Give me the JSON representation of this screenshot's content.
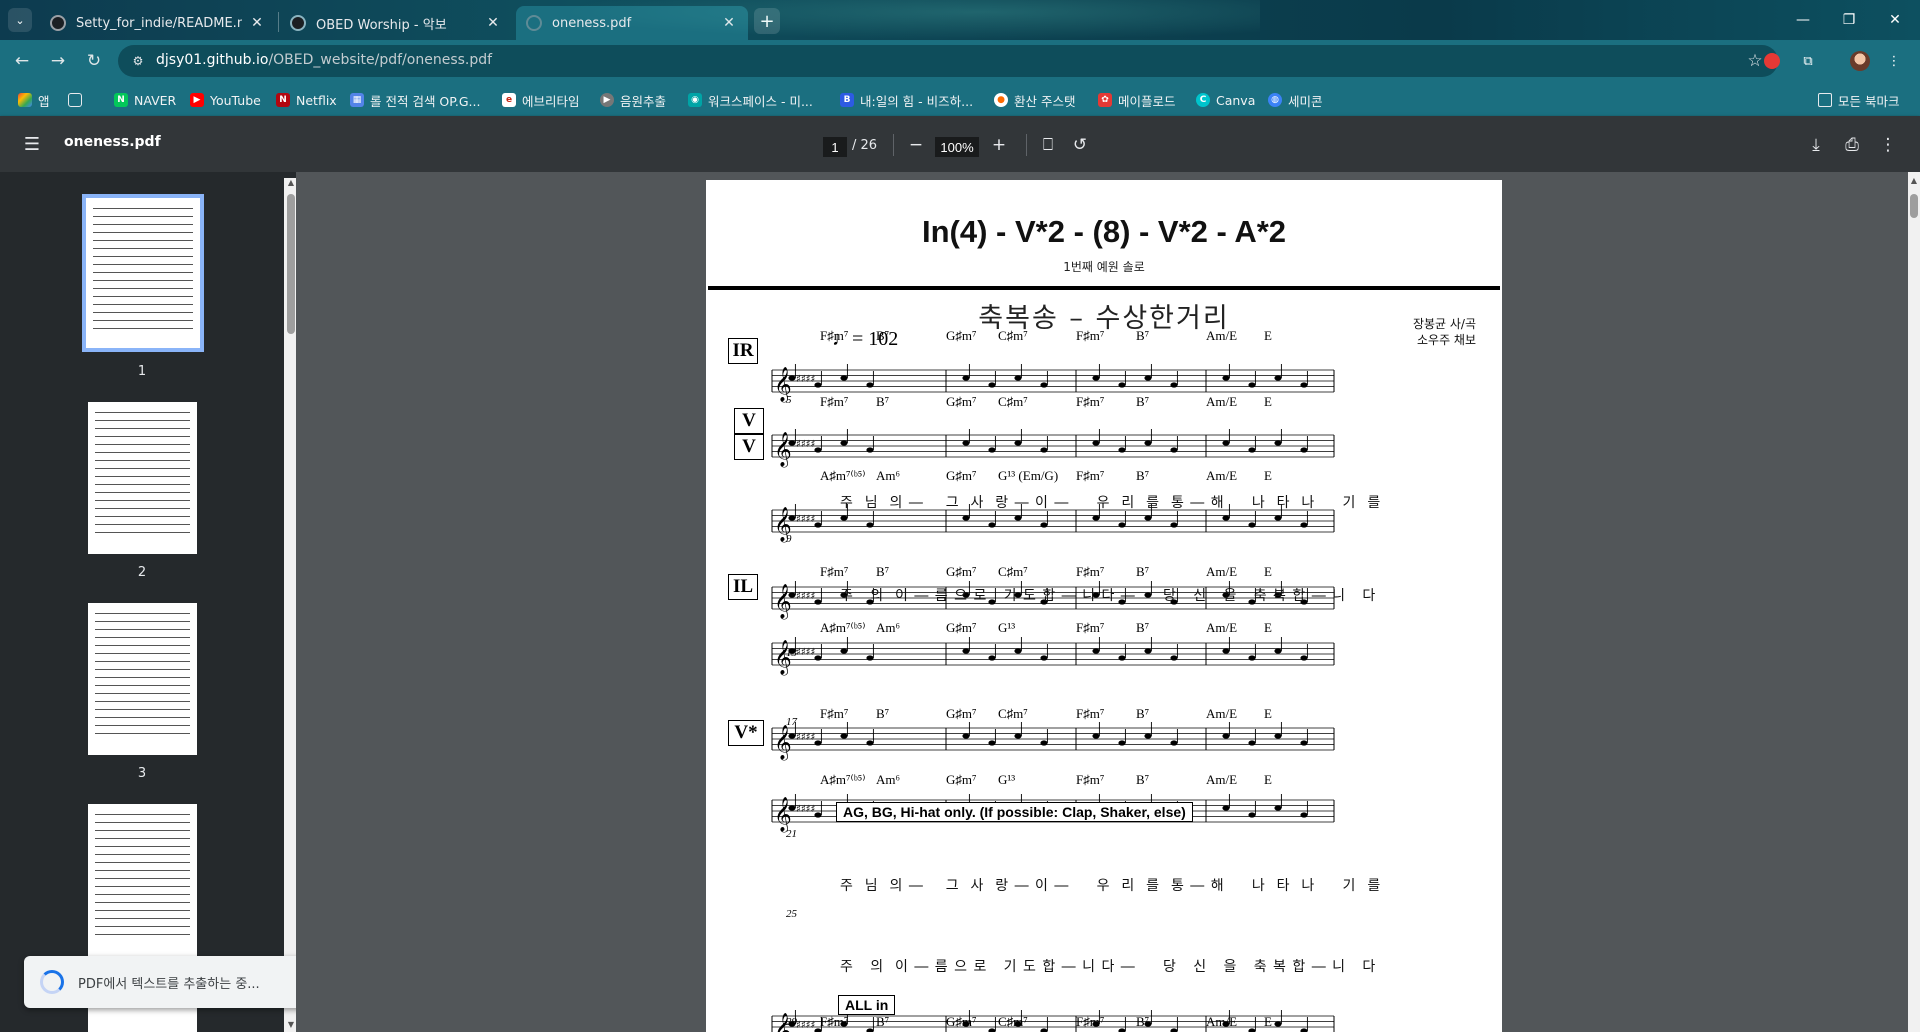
{
  "tabs": [
    {
      "title": "Setty_for_indie/README.md at",
      "close": "✕"
    },
    {
      "title": "OBED Worship - 악보",
      "close": "✕"
    },
    {
      "title": "oneness.pdf",
      "close": "✕"
    }
  ],
  "address": {
    "host": "djsy01.github.io",
    "path": "/OBED_website/pdf/oneness.pdf"
  },
  "bookmarks": {
    "items": [
      {
        "label": "앱",
        "color": "#ea4335"
      },
      {
        "label": "",
        "color": "#5f6368"
      },
      {
        "label": "NAVER",
        "color": "#03c75a"
      },
      {
        "label": "YouTube",
        "color": "#ff0000"
      },
      {
        "label": "Netflix",
        "color": "#b20710"
      },
      {
        "label": "롤 전적 검색 OP.G...",
        "color": "#5383e8"
      },
      {
        "label": "에브리타임",
        "color": "#c62917"
      },
      {
        "label": "음원추출",
        "color": "#444444"
      },
      {
        "label": "워크스페이스 - 미...",
        "color": "#00a4a6"
      },
      {
        "label": "내:일의 힘 - 비즈하...",
        "color": "#2d5be3"
      },
      {
        "label": "환산 주스탯",
        "color": "#ff6b00"
      },
      {
        "label": "메이플로드",
        "color": "#e53935"
      },
      {
        "label": "Canva",
        "color": "#00c4cc"
      },
      {
        "label": "세미콘",
        "color": "#3b82f6"
      }
    ],
    "all_bookmarks": "모든 북마크"
  },
  "pdf": {
    "filename": "oneness.pdf",
    "page_current": "1",
    "page_total": "/ 26",
    "zoom": "100%"
  },
  "thumbnails": [
    "1",
    "2",
    "3"
  ],
  "toast": "PDF에서 텍스트를 추출하는 중...",
  "sheet": {
    "header_title": "In(4) - V*2 - (8) - V*2 - A*2",
    "header_sub": "1번째 예원 솔로",
    "song_title": "축복송 – 수상한거리",
    "composer_1": "장봉균 사/곡",
    "composer_2": "소우주 채보",
    "tempo": "♩= 102",
    "labels": {
      "ir": "IR",
      "v1": "V",
      "v2": "V",
      "il": "IL",
      "vstar": "V*"
    },
    "measure_numbers": {
      "m5": "5",
      "m9": "9",
      "m13": "13",
      "m17": "17",
      "m21": "21",
      "m25": "25",
      "m29": "29"
    },
    "chords": {
      "r1": [
        "F♯m⁷",
        "B⁷",
        "G♯m⁷",
        "C♯m⁷",
        "F♯m⁷",
        "B⁷",
        "Am/E",
        "E"
      ],
      "r2": [
        "F♯m⁷",
        "B⁷",
        "G♯m⁷",
        "C♯m⁷",
        "F♯m⁷",
        "B⁷",
        "Am/E",
        "E"
      ],
      "r3": [
        "A♯m⁷⁽ᵇ⁵⁾",
        "Am⁶",
        "G♯m⁷",
        "G¹³ (Em/G)",
        "F♯m⁷",
        "B⁷",
        "Am/E",
        "E"
      ],
      "r4": [
        "F♯m⁷",
        "B⁷",
        "G♯m⁷",
        "C♯m⁷",
        "F♯m⁷",
        "B⁷",
        "Am/E",
        "E"
      ],
      "r5": [
        "A♯m⁷⁽ᵇ⁵⁾",
        "Am⁶",
        "G♯m⁷",
        "G¹³",
        "F♯m⁷",
        "B⁷",
        "Am/E",
        "E"
      ],
      "r6": [
        "F♯m⁷",
        "B⁷",
        "G♯m⁷",
        "C♯m⁷",
        "F♯m⁷",
        "B⁷",
        "Am/E",
        "E"
      ],
      "r7": [
        "A♯m⁷⁽ᵇ⁵⁾",
        "Am⁶",
        "G♯m⁷",
        "G¹³",
        "F♯m⁷",
        "B⁷",
        "Am/E",
        "E"
      ],
      "r8": [
        "F♯m⁷",
        "B⁷",
        "G♯m⁷",
        "C♯m⁷",
        "F♯m⁷",
        "B⁷",
        "Am/E",
        "E"
      ]
    },
    "lyrics": {
      "l1": "주  님  의 ―    그  사  랑 ― 이 ―     우  리  를  통 ― 해     나  타  나     기  를",
      "l2": "주   의  이 ― 름 으 로   기 도 합 ― 니 다 ―     당   신   을   축 복 합 ― 니   다",
      "l3": "주  님  의 ―    그  사  랑 ― 이 ―     우  리  를  통 ― 해     나  타  나     기  를",
      "l4": "주   의  이 ― 름 으 로   기 도 합 ― 니 다 ―     당   신   을   축 복 합 ― 니   다"
    },
    "notes": {
      "ag_note": "AG, BG, Hi-hat only. (If possible: Clap, Shaker, else)",
      "all_in": "ALL in"
    }
  }
}
